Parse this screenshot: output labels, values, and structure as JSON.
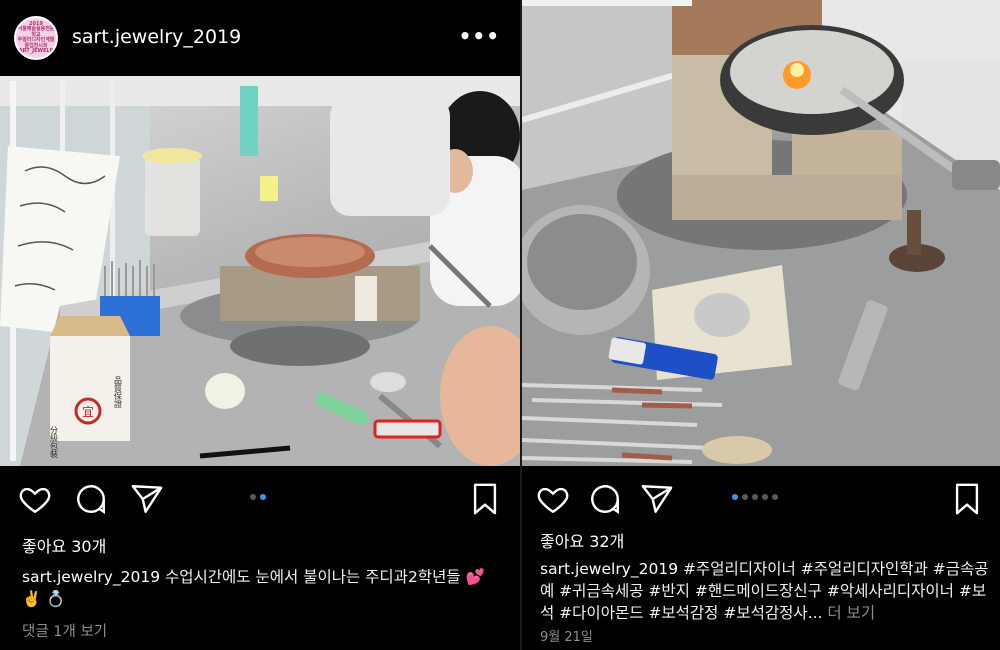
{
  "post1": {
    "avatar_text": [
      "2019",
      "서울예술실용전문학교",
      "주얼리디자인계열",
      "졸업전시회",
      "SART_JEWELRY"
    ],
    "username": "sart.jewelry_2019",
    "more_icon": "more-horizontal-icon",
    "likes": "좋아요 30개",
    "caption_user": "sart.jewelry_2019",
    "caption_text": "수업시간에도 눈에서 불이나는 주디과2학년들 💕 ✌️ 💍",
    "comments_link": "댓글 1개 보기",
    "carousel": {
      "count": 2,
      "active": 1
    },
    "box_label_1": "分級包裝",
    "box_label_2": "品質保證",
    "box_stamp": "宜"
  },
  "post2": {
    "likes": "좋아요 32개",
    "caption_user": "sart.jewelry_2019",
    "caption_text": "#주얼리디자이너 #주얼리디자인학과 #금속공예 #귀금속세공 #반지 #핸드메이드장신구 #악세사리디자이너 #보석 #다이아몬드 #보석감정 #보석감정사...",
    "caption_more": "더 보기",
    "date": "9월 21일",
    "carousel": {
      "count": 5,
      "active": 0
    }
  },
  "icons": {
    "like": "heart-icon",
    "comment": "comment-icon",
    "share": "send-icon",
    "save": "bookmark-icon"
  },
  "colors": {
    "background": "#000000",
    "text": "#f5f5f5",
    "muted": "#8e8e8e",
    "carousel_active": "#3897f0"
  }
}
